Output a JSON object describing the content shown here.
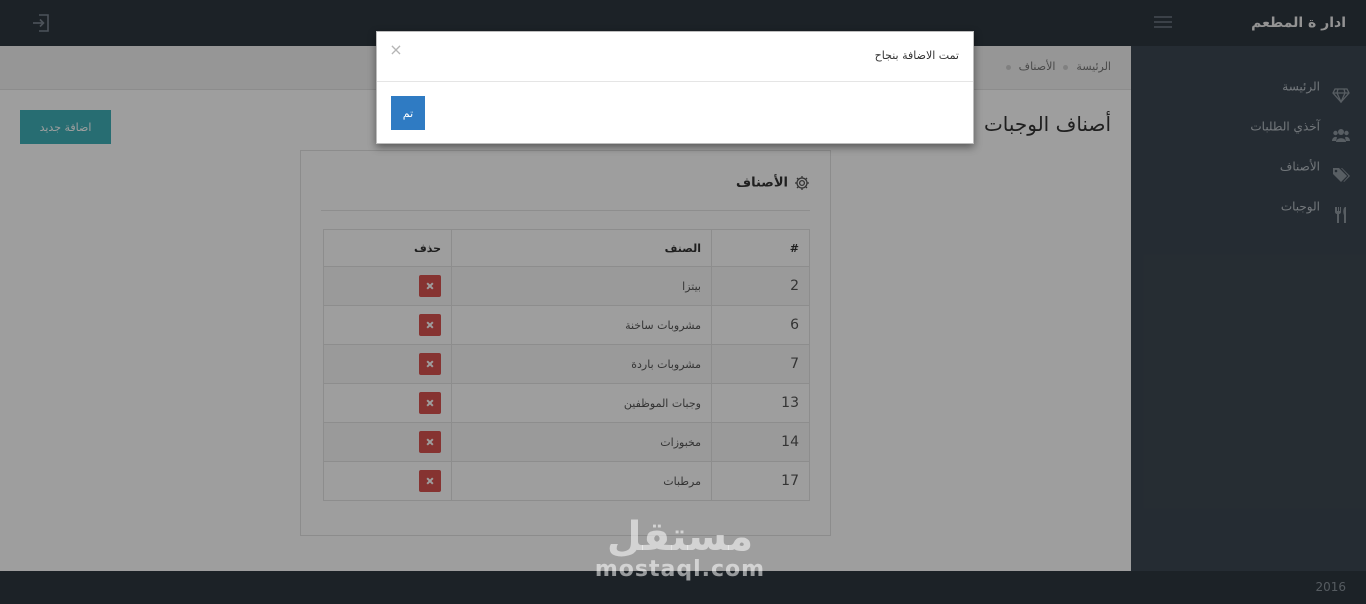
{
  "app": {
    "brand": "ادار ة المطعم"
  },
  "sidebar": {
    "items": [
      {
        "label": "الرئيسة",
        "icon": "diamond-icon"
      },
      {
        "label": "آخذي الطلبات",
        "icon": "users-icon"
      },
      {
        "label": "الأصناف",
        "icon": "tags-icon"
      },
      {
        "label": "الوجبات",
        "icon": "utensils-icon"
      }
    ]
  },
  "breadcrumb": {
    "home": "الرئيسة",
    "current": "الأصناف"
  },
  "page": {
    "title": "أصناف الوجبات",
    "add_label": "اضافة جديد"
  },
  "panel": {
    "title": "الأصناف",
    "table": {
      "headers": {
        "num": "#",
        "name": "الصنف",
        "delete": "حذف"
      },
      "rows": [
        {
          "id": "2",
          "name": "بيتزا"
        },
        {
          "id": "6",
          "name": "مشروبات ساخنة"
        },
        {
          "id": "7",
          "name": "مشروبات باردة"
        },
        {
          "id": "13",
          "name": "وجبات الموظفين"
        },
        {
          "id": "14",
          "name": "مخبوزات"
        },
        {
          "id": "17",
          "name": "مرطبات"
        }
      ]
    }
  },
  "modal": {
    "message": "تمت الاضافة بنجاح",
    "close_symbol": "×",
    "ok_label": "تم"
  },
  "footer": {
    "year": "2016"
  },
  "watermark": {
    "arabic": "مستقل",
    "latin": "mostaql.com"
  },
  "colors": {
    "topbar": "#2e3740",
    "sidebar": "#3d4853",
    "add_button": "#3fb1b8",
    "ok_button": "#2f7bc3",
    "delete_button": "#d9534f"
  }
}
